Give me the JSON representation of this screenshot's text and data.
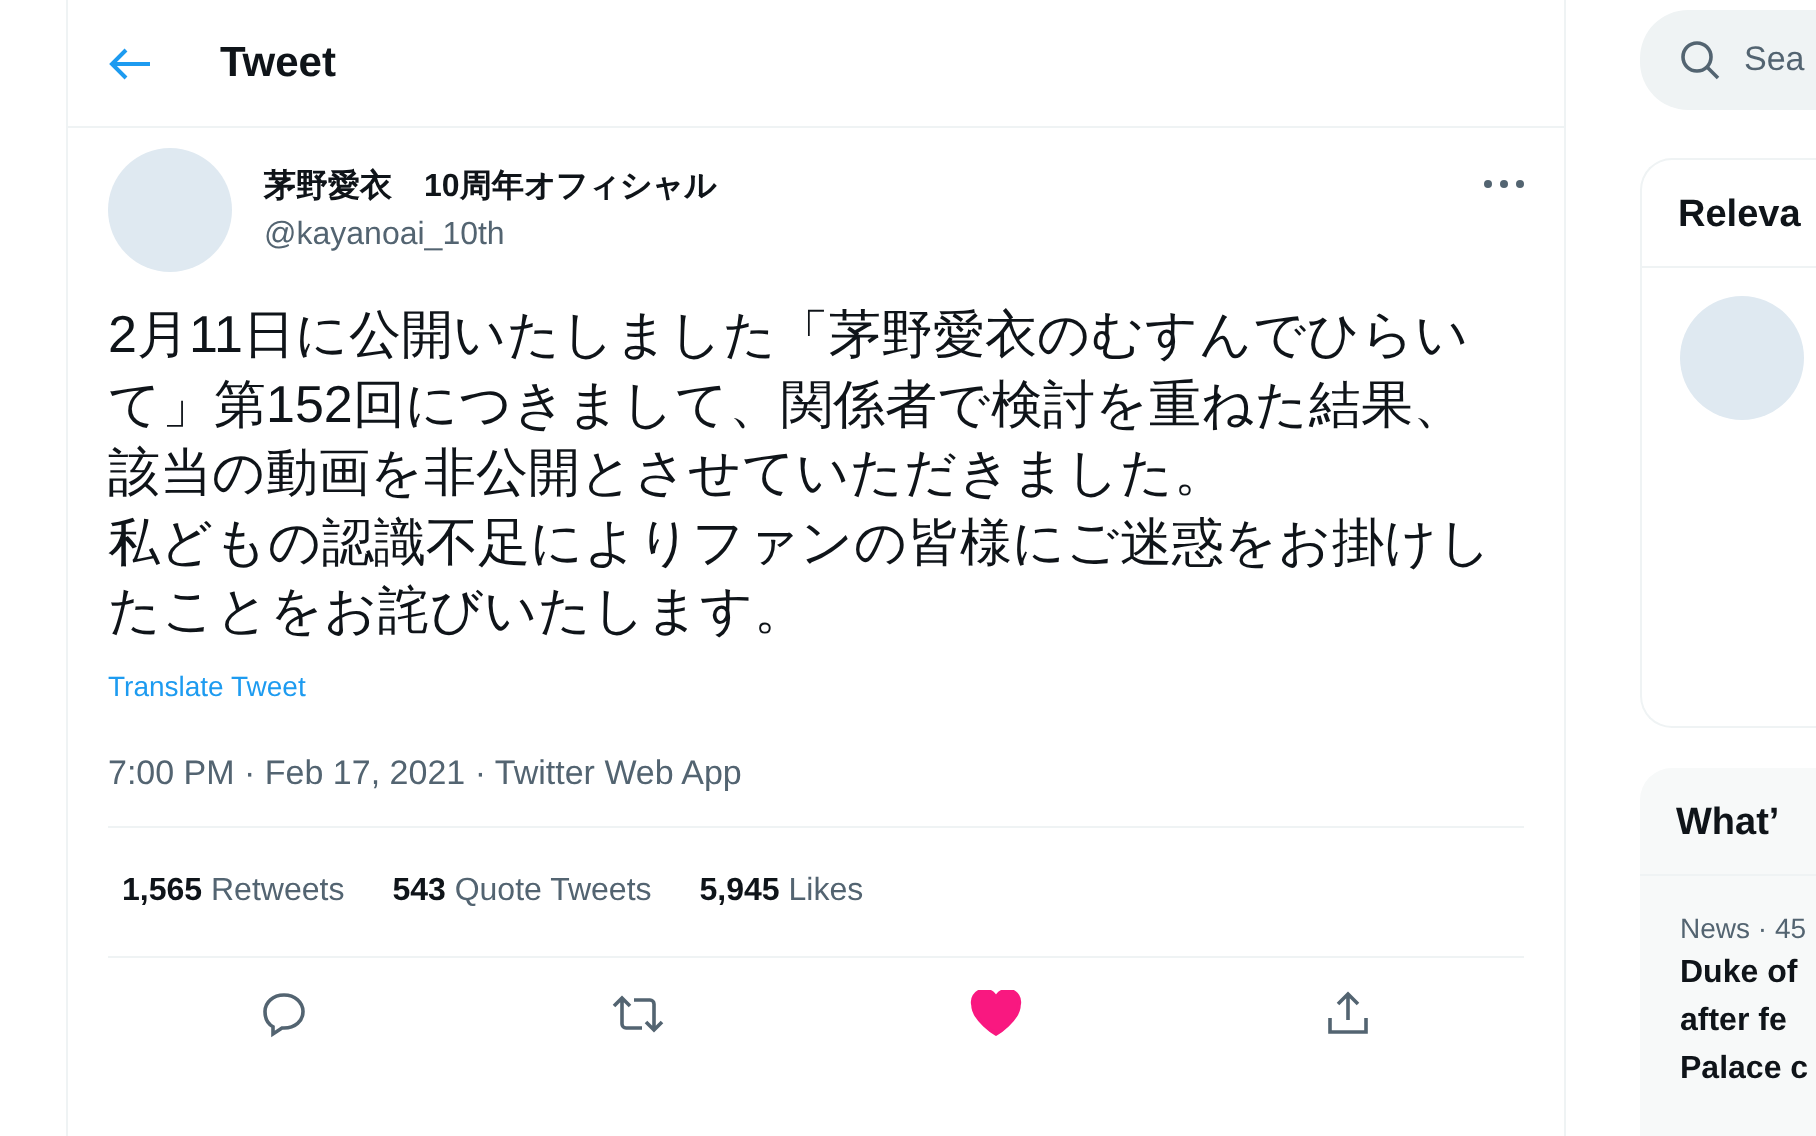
{
  "header": {
    "title": "Tweet"
  },
  "tweet": {
    "author_name": "茅野愛衣　10周年オフィシャル",
    "handle": "@kayanoai_10th",
    "paragraphs": [
      "2月11日に公開いたしました「茅野愛衣のむすんでひらいて」第152回につきまして、関係者で検討を重ねた結果、該当の動画を非公開とさせていただきました。",
      "私どもの認識不足によりファンの皆様にご迷惑をお掛けしたことをお詫びいたします。"
    ],
    "translate": "Translate Tweet",
    "meta": "7:00 PM · Feb 17, 2021 · Twitter Web App",
    "stats": [
      {
        "count": "1,565",
        "label": "Retweets"
      },
      {
        "count": "543",
        "label": "Quote Tweets"
      },
      {
        "count": "5,945",
        "label": "Likes"
      }
    ],
    "liked": true
  },
  "sidebar": {
    "search_placeholder": "Sea",
    "relevant_title": "Releva",
    "trends_title": "What’",
    "trend": {
      "meta": "News · 45",
      "headline": [
        "Duke of",
        "after fe",
        "Palace c"
      ]
    }
  }
}
